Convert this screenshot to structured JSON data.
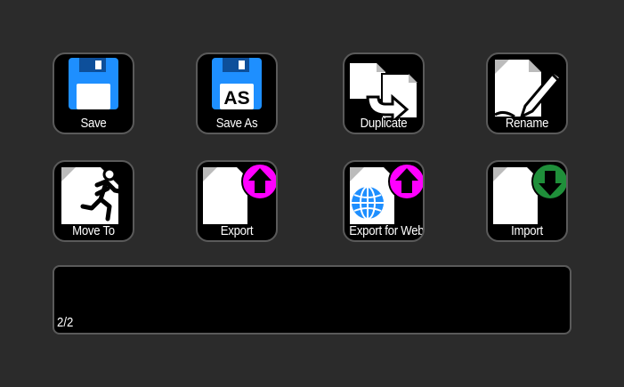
{
  "buttons": {
    "save": "Save",
    "save_as": "Save As",
    "save_as_badge": "AS",
    "duplicate": "Duplicate",
    "rename": "Rename",
    "move_to": "Move To",
    "export": "Export",
    "export_web": "Export for Web",
    "import": "Import"
  },
  "icons": {
    "save": "floppy-disk-icon",
    "save_as": "floppy-disk-as-icon",
    "duplicate": "duplicate-files-icon",
    "rename": "file-pencil-icon",
    "move_to": "file-running-man-icon",
    "export": "file-upload-arrow-icon",
    "export_web": "file-globe-upload-icon",
    "import": "file-download-arrow-icon"
  },
  "colors": {
    "background": "#2b2b2b",
    "button_face": "#000000",
    "border": "#5a5a5a",
    "floppy_blue": "#1e8fff",
    "export_magenta": "#ff00ff",
    "import_green": "#1f8f3a",
    "globe_blue": "#1e8fff"
  },
  "status": {
    "pager": "2/2"
  }
}
